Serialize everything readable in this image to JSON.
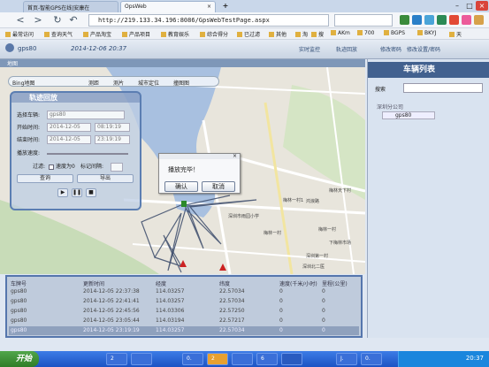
{
  "browser": {
    "tabs": [
      {
        "label": "首页-智能GPS在线|安康在"
      },
      {
        "label": "OpsWeb"
      }
    ],
    "url": "http://219.133.34.196:8086/GpsWebTestPage.aspx",
    "bookmarks": [
      "最常访问",
      "查询天气",
      "产品淘宝",
      "产品项目",
      "教育娱乐",
      "综合得分",
      "已过滤",
      "其他",
      "淘",
      "搜",
      "AKm",
      "700",
      "BGPS",
      "BKYJ",
      "天"
    ]
  },
  "app": {
    "user": "gps80",
    "date": "2014-12-06 20:37",
    "actions": [
      "实时监控",
      "轨迹回放"
    ],
    "status": "地图"
  },
  "map": {
    "tools": [
      "Bing地图",
      "测距",
      "测片",
      "城市定位",
      "撞图图"
    ],
    "labels": [
      "深圳市雨园小学",
      "梅林一村",
      "下梅林市场",
      "深圳第一村",
      "深圳北二医",
      "梅林一村1",
      "鸿浪路",
      "梅林天下村",
      "梅林一村"
    ]
  },
  "playback": {
    "title": "轨迹回放",
    "vehicle_label": "选择车辆:",
    "vehicle_value": "gps80",
    "start_label": "开始时间:",
    "start_date": "2014-12-05",
    "start_time": "08:19:19",
    "end_label": "结束时间:",
    "end_date": "2014-12-05",
    "end_time": "23:19:19",
    "speed_label": "播放速度:",
    "filter_label": "过滤:",
    "filter_speed": "速度为0",
    "filter_cycle": "标记间隔:",
    "query": "查询",
    "export": "导出"
  },
  "dialog": {
    "message": "播放完毕！",
    "ok": "确认",
    "cancel": "取消"
  },
  "table": {
    "columns": [
      "车牌号",
      "更新时间",
      "经度",
      "纬度",
      "速度(千米/小时)",
      "里程(公里)"
    ],
    "rows": [
      [
        "gps80",
        "2014-12-05 22:37:38",
        "114.03257",
        "22.57034",
        "0",
        "0"
      ],
      [
        "gps80",
        "2014-12-05 22:41:41",
        "114.03257",
        "22.57034",
        "0",
        "0"
      ],
      [
        "gps80",
        "2014-12-05 22:45:56",
        "114.03306",
        "22.57250",
        "0",
        "0"
      ],
      [
        "gps80",
        "2014-12-05 23:05:44",
        "114.03194",
        "22.57217",
        "0",
        "0"
      ],
      [
        "gps80",
        "2014-12-05 23:19:19",
        "114.03257",
        "22.57034",
        "0",
        "0"
      ]
    ]
  },
  "vehicles": {
    "title": "车辆列表",
    "search_label": "搜索",
    "group": "深圳分公司",
    "item": "gps80",
    "top_actions": [
      "修改密码",
      "修改设置/密码"
    ]
  },
  "taskbar": {
    "start": "开始",
    "tasks": [
      "2",
      "",
      "0.",
      "2",
      "",
      "6",
      "",
      "J.",
      "0."
    ],
    "time": "20:37"
  }
}
